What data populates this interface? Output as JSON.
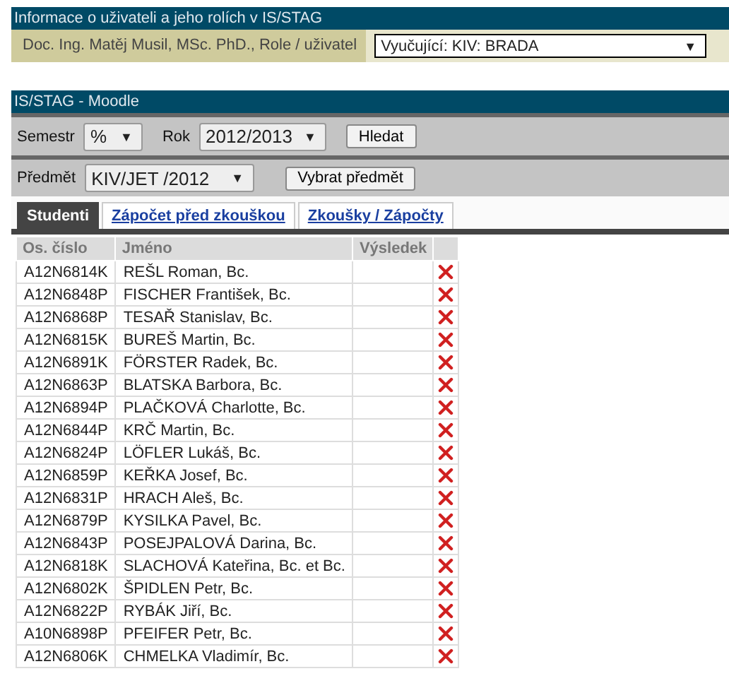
{
  "user_panel": {
    "title": "Informace o uživateli a jeho rolích v IS/STAG",
    "user_label": "Doc. Ing. Matěj Musil, MSc. PhD., Role / uživatel",
    "role_select": {
      "value": "Vyučující: KIV: BRADA",
      "arrow": "▼"
    }
  },
  "moodle_panel": {
    "title": "IS/STAG - Moodle",
    "filters": [
      {
        "label": "Semestr",
        "value": "%",
        "arrow": "▼"
      },
      {
        "label": "Rok",
        "value": "2012/2013",
        "arrow": "▼"
      }
    ],
    "search_button": "Hledat",
    "subject": {
      "label": "Předmět",
      "value": "KIV/JET /2012",
      "arrow": "▼"
    },
    "subject_button": "Vybrat předmět",
    "tabs": [
      {
        "label": "Studenti",
        "selected": true
      },
      {
        "label": "Zápočet před zkouškou",
        "selected": false
      },
      {
        "label": "Zkoušky / Zápočty",
        "selected": false
      }
    ],
    "table": {
      "columns": [
        "Os. číslo",
        "Jméno",
        "Výsledek"
      ],
      "rows": [
        {
          "id": "A12N6814K",
          "name": "REŠL Roman, Bc."
        },
        {
          "id": "A12N6848P",
          "name": "FISCHER František, Bc."
        },
        {
          "id": "A12N6868P",
          "name": "TESAŘ Stanislav, Bc."
        },
        {
          "id": "A12N6815K",
          "name": "BUREŠ Martin, Bc."
        },
        {
          "id": "A12N6891K",
          "name": "FÖRSTER Radek, Bc."
        },
        {
          "id": "A12N6863P",
          "name": "BLATSKA Barbora, Bc."
        },
        {
          "id": "A12N6894P",
          "name": "PLAČKOVÁ Charlotte, Bc."
        },
        {
          "id": "A12N6844P",
          "name": "KRČ Martin, Bc."
        },
        {
          "id": "A12N6824P",
          "name": "LÖFLER Lukáš, Bc."
        },
        {
          "id": "A12N6859P",
          "name": "KEŘKA Josef, Bc."
        },
        {
          "id": "A12N6831P",
          "name": "HRACH Aleš, Bc."
        },
        {
          "id": "A12N6879P",
          "name": "KYSILKA Pavel, Bc."
        },
        {
          "id": "A12N6843P",
          "name": "POSEJPALOVÁ Darina, Bc."
        },
        {
          "id": "A12N6818K",
          "name": "SLACHOVÁ Kateřina, Bc. et Bc."
        },
        {
          "id": "A12N6802K",
          "name": "ŠPIDLEN Petr, Bc."
        },
        {
          "id": "A12N6822P",
          "name": "RYBÁK Jiří, Bc."
        },
        {
          "id": "A10N6898P",
          "name": "PFEIFER Petr, Bc."
        },
        {
          "id": "A12N6806K",
          "name": "CHMELKA Vladimír, Bc."
        }
      ]
    }
  }
}
